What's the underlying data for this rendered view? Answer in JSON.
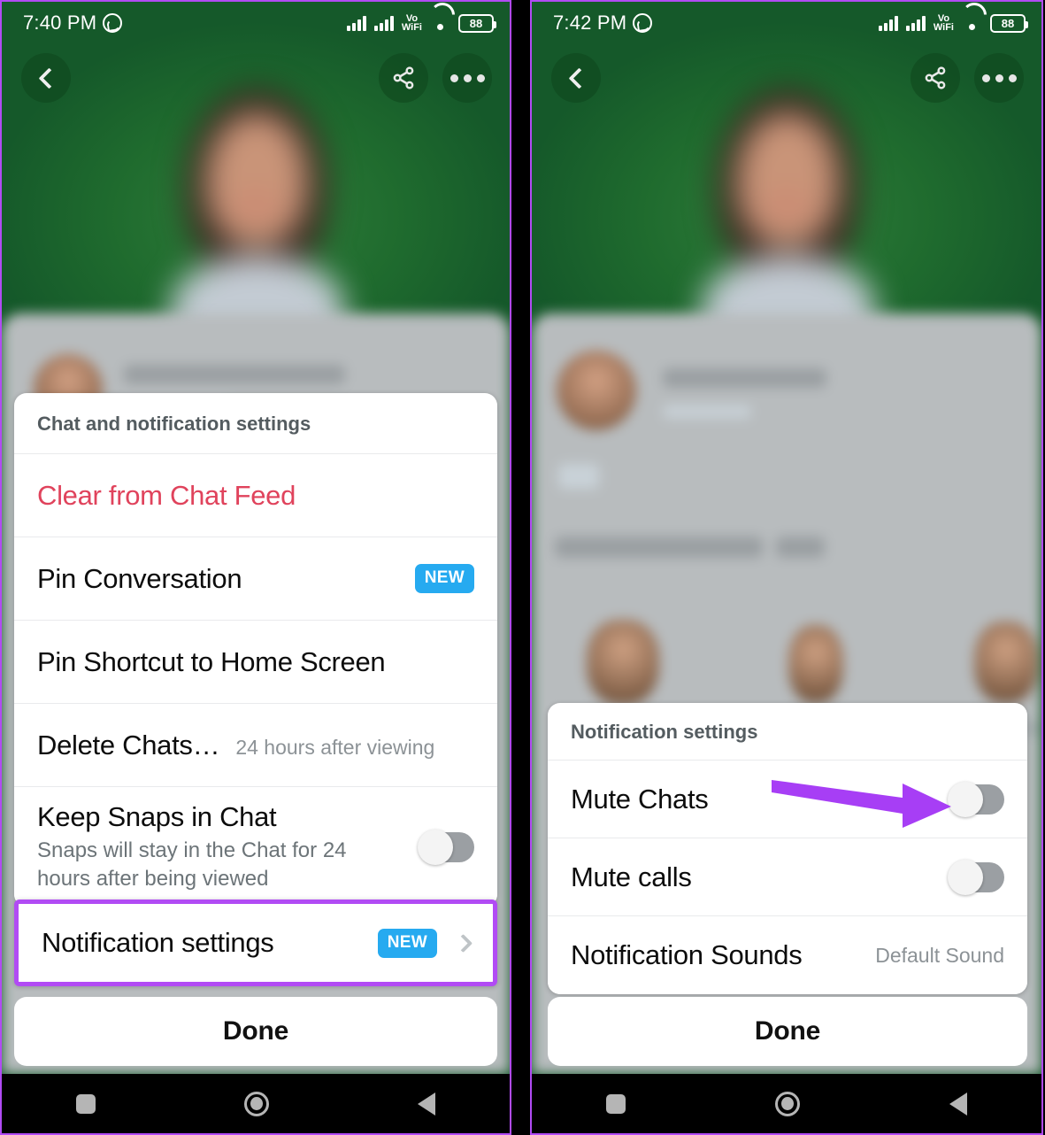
{
  "screens": [
    {
      "id": "chat-settings-screen",
      "status_bar": {
        "time": "7:40 PM",
        "app_icon": "whatsapp-icon",
        "signal_1": "signal-bars-icon",
        "signal_2": "signal-bars-icon",
        "vowifi_line1": "Vo",
        "vowifi_line2": "WiFi",
        "wifi": "wifi-icon",
        "battery_percent": "88"
      },
      "topnav": {
        "back": "back-chevron-icon",
        "share": "share-icon",
        "more": "more-options-icon"
      },
      "sheet": {
        "title": "Chat and notification settings",
        "rows": [
          {
            "label": "Clear from Chat Feed",
            "style": "danger"
          },
          {
            "label": "Pin Conversation",
            "badge": "NEW"
          },
          {
            "label": "Pin Shortcut to Home Screen"
          },
          {
            "label": "Delete Chats…",
            "value": "24 hours after viewing"
          },
          {
            "label": "Keep Snaps in Chat",
            "sub": "Snaps will stay in the Chat for 24 hours after being viewed",
            "toggle": "off"
          },
          {
            "label": "Notification settings",
            "badge": "NEW",
            "chevron": "chevron-right-icon",
            "highlighted": true
          }
        ]
      },
      "done_label": "Done",
      "android_nav": {
        "recents": "square-recents-icon",
        "home": "circle-home-icon",
        "back": "triangle-back-icon"
      }
    },
    {
      "id": "notification-settings-screen",
      "status_bar": {
        "time": "7:42 PM",
        "app_icon": "whatsapp-icon",
        "signal_1": "signal-bars-icon",
        "signal_2": "signal-bars-icon",
        "vowifi_line1": "Vo",
        "vowifi_line2": "WiFi",
        "wifi": "wifi-icon",
        "battery_percent": "88"
      },
      "topnav": {
        "back": "back-chevron-icon",
        "share": "share-icon",
        "more": "more-options-icon"
      },
      "sheet": {
        "title": "Notification settings",
        "rows": [
          {
            "label": "Mute Chats",
            "toggle": "off",
            "annotated": true
          },
          {
            "label": "Mute calls",
            "toggle": "off"
          },
          {
            "label": "Notification Sounds",
            "value": "Default Sound"
          }
        ]
      },
      "done_label": "Done",
      "android_nav": {
        "recents": "square-recents-icon",
        "home": "circle-home-icon",
        "back": "triangle-back-icon"
      }
    }
  ],
  "annotations": {
    "arrow_color": "#a73ef5",
    "highlight_color": "#b14bf4",
    "badge_color": "#26aaf0",
    "danger_color": "#e0435c"
  }
}
